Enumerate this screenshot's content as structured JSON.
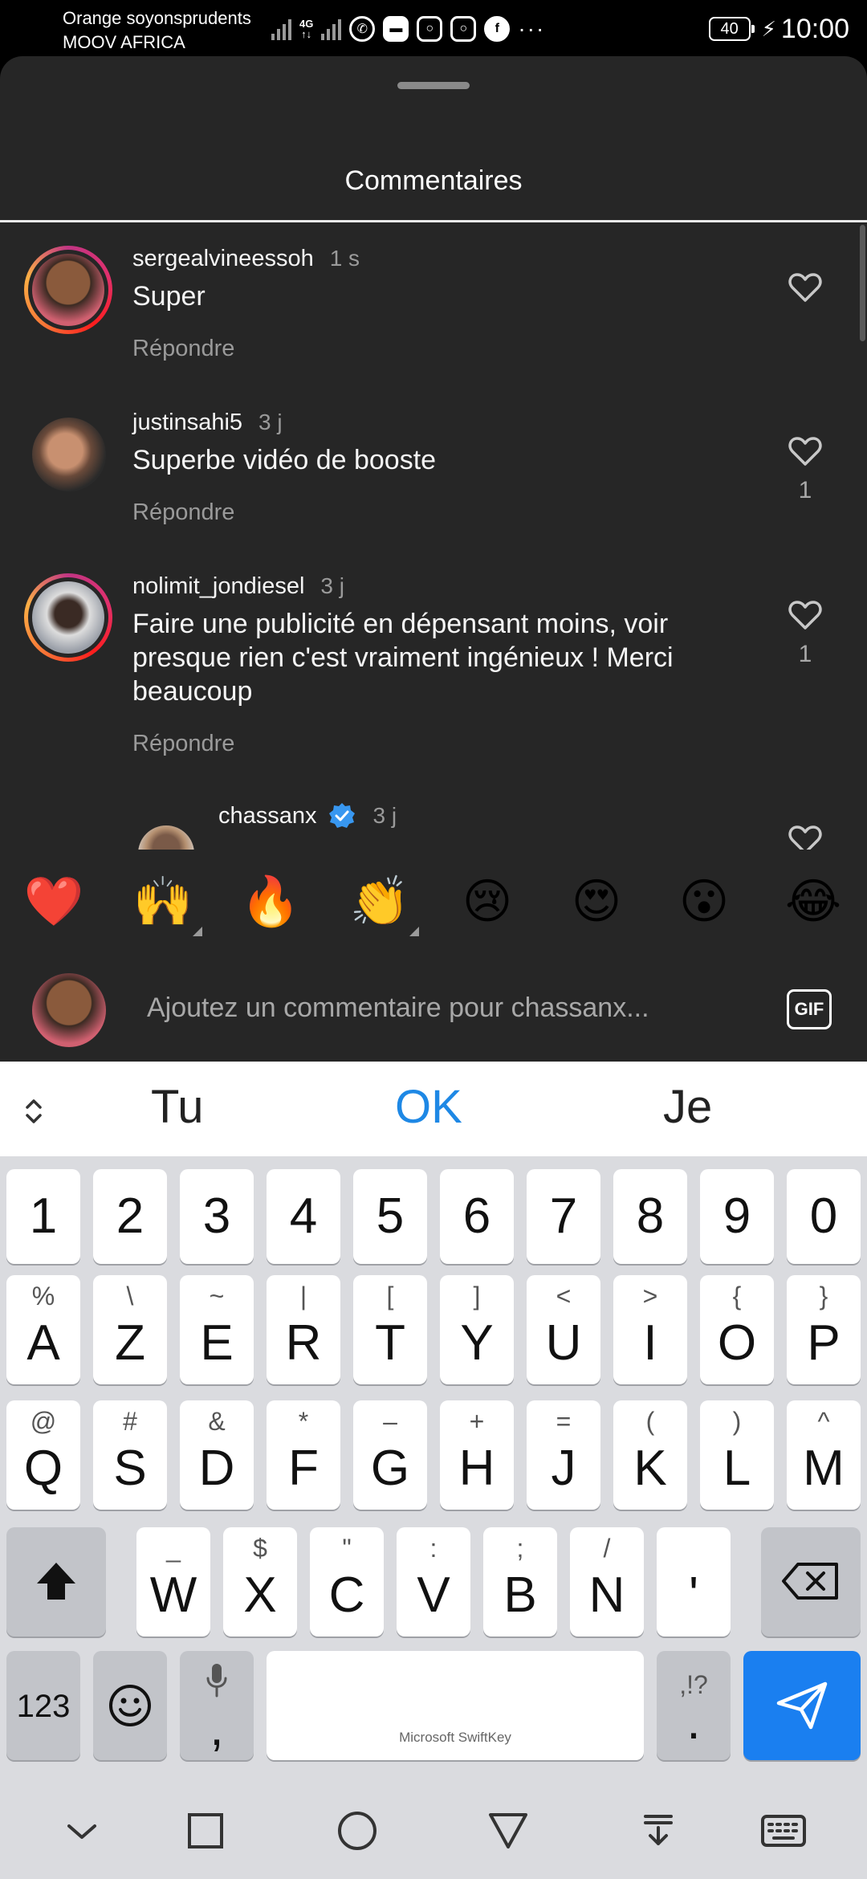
{
  "status_bar": {
    "carrier_line1": "Orange soyonsprudents",
    "carrier_line2": "MOOV AFRICA",
    "network": "4G",
    "battery": "40",
    "time": "10:00",
    "app_icons": [
      "whatsapp-icon",
      "messages-icon",
      "instagram-icon",
      "instagram-icon",
      "facebook-icon",
      "more-icon"
    ]
  },
  "sheet": {
    "title": "Commentaires"
  },
  "comments": [
    {
      "username": "sergealvineessoh",
      "time": "1 s",
      "text": "Super",
      "reply": "Répondre",
      "likes": ""
    },
    {
      "username": "justinsahi5",
      "time": "3 j",
      "text": "Superbe vidéo de booste",
      "reply": "Répondre",
      "likes": "1"
    },
    {
      "username": "nolimit_jondiesel",
      "time": "3 j",
      "text": "Faire une publicité en dépensant moins, voir presque rien c'est vraiment ingénieux ! Merci beaucoup",
      "reply": "Répondre",
      "likes": "1"
    },
    {
      "username": "chassanx",
      "time": "3 j",
      "verified": true
    }
  ],
  "emoji_bar": [
    "❤️",
    "🙌",
    "🔥",
    "👏",
    "😢",
    "😍",
    "😮",
    "😂"
  ],
  "composer": {
    "placeholder": "Ajoutez un commentaire pour chassanx...",
    "gif_label": "GIF"
  },
  "keyboard": {
    "suggestions": [
      "Tu",
      "OK",
      "Je"
    ],
    "number_row": [
      "1",
      "2",
      "3",
      "4",
      "5",
      "6",
      "7",
      "8",
      "9",
      "0"
    ],
    "row1": [
      {
        "main": "A",
        "sec": "%"
      },
      {
        "main": "Z",
        "sec": "\\"
      },
      {
        "main": "E",
        "sec": "~"
      },
      {
        "main": "R",
        "sec": "|"
      },
      {
        "main": "T",
        "sec": "["
      },
      {
        "main": "Y",
        "sec": "]"
      },
      {
        "main": "U",
        "sec": "<"
      },
      {
        "main": "I",
        "sec": ">"
      },
      {
        "main": "O",
        "sec": "{"
      },
      {
        "main": "P",
        "sec": "}"
      }
    ],
    "row2": [
      {
        "main": "Q",
        "sec": "@"
      },
      {
        "main": "S",
        "sec": "#"
      },
      {
        "main": "D",
        "sec": "&"
      },
      {
        "main": "F",
        "sec": "*"
      },
      {
        "main": "G",
        "sec": "–"
      },
      {
        "main": "H",
        "sec": "+"
      },
      {
        "main": "J",
        "sec": "="
      },
      {
        "main": "K",
        "sec": "("
      },
      {
        "main": "L",
        "sec": ")"
      },
      {
        "main": "M",
        "sec": "^"
      }
    ],
    "row3": [
      {
        "main": "W",
        "sec": "_"
      },
      {
        "main": "X",
        "sec": "$"
      },
      {
        "main": "C",
        "sec": "\""
      },
      {
        "main": "V",
        "sec": ":"
      },
      {
        "main": "B",
        "sec": ";"
      },
      {
        "main": "N",
        "sec": "/"
      },
      {
        "main": "'",
        "sec": ""
      }
    ],
    "num_toggle": "123",
    "comma": ",",
    "period": ".",
    "period_sec": ",!?",
    "space_brand": "Microsoft SwiftKey"
  },
  "colors": {
    "sheet_bg": "#262626",
    "accent_blue": "#1a7ff0",
    "suggestion_accent": "#1e88e5",
    "keyboard_bg": "#dadbdf"
  }
}
